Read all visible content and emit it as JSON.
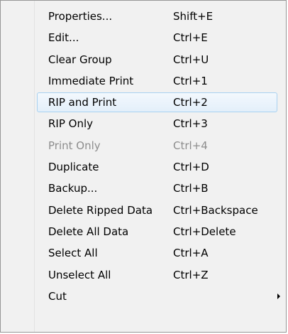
{
  "menu": {
    "items": [
      {
        "label": "Properties...",
        "shortcut": "Shift+E",
        "enabled": true,
        "hovered": false,
        "submenu": false
      },
      {
        "label": "Edit...",
        "shortcut": "Ctrl+E",
        "enabled": true,
        "hovered": false,
        "submenu": false
      },
      {
        "label": "Clear Group",
        "shortcut": "Ctrl+U",
        "enabled": true,
        "hovered": false,
        "submenu": false
      },
      {
        "label": "Immediate Print",
        "shortcut": "Ctrl+1",
        "enabled": true,
        "hovered": false,
        "submenu": false
      },
      {
        "label": "RIP and Print",
        "shortcut": "Ctrl+2",
        "enabled": true,
        "hovered": true,
        "submenu": false
      },
      {
        "label": "RIP Only",
        "shortcut": "Ctrl+3",
        "enabled": true,
        "hovered": false,
        "submenu": false
      },
      {
        "label": "Print Only",
        "shortcut": "Ctrl+4",
        "enabled": false,
        "hovered": false,
        "submenu": false
      },
      {
        "label": "Duplicate",
        "shortcut": "Ctrl+D",
        "enabled": true,
        "hovered": false,
        "submenu": false
      },
      {
        "label": "Backup...",
        "shortcut": "Ctrl+B",
        "enabled": true,
        "hovered": false,
        "submenu": false
      },
      {
        "label": "Delete Ripped Data",
        "shortcut": "Ctrl+Backspace",
        "enabled": true,
        "hovered": false,
        "submenu": false
      },
      {
        "label": "Delete All Data",
        "shortcut": "Ctrl+Delete",
        "enabled": true,
        "hovered": false,
        "submenu": false
      },
      {
        "label": "Select All",
        "shortcut": "Ctrl+A",
        "enabled": true,
        "hovered": false,
        "submenu": false
      },
      {
        "label": "Unselect All",
        "shortcut": "Ctrl+Z",
        "enabled": true,
        "hovered": false,
        "submenu": false
      },
      {
        "label": "Cut",
        "shortcut": "",
        "enabled": true,
        "hovered": false,
        "submenu": true
      }
    ],
    "colors": {
      "background": "#f1f1f1",
      "border": "#979797",
      "text": "#000000",
      "disabled_text": "#8d8d8d",
      "hover_border": "#a8d1f0"
    }
  }
}
